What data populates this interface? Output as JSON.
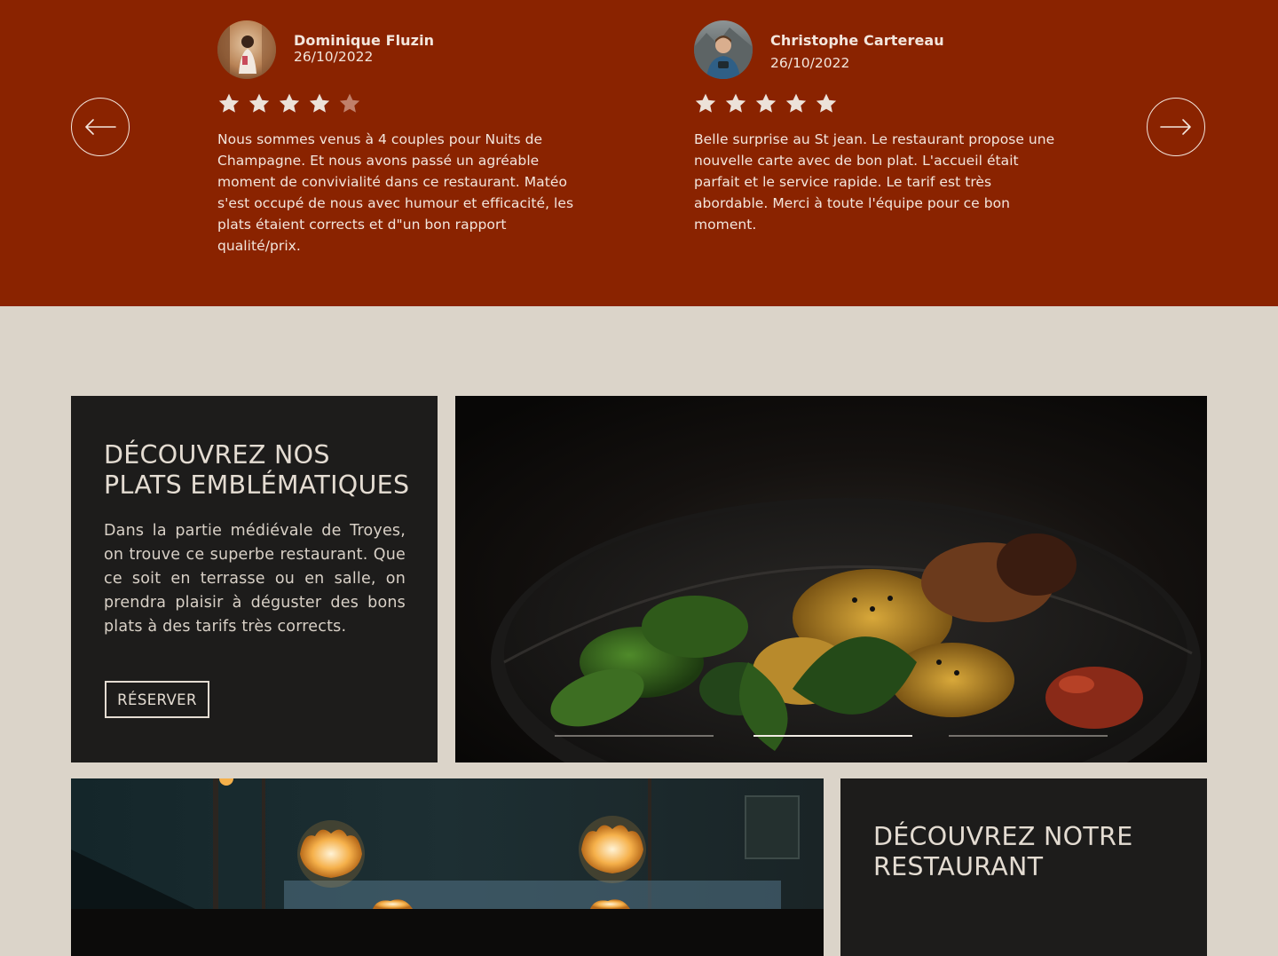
{
  "reviews": {
    "prev_icon": "arrow-left-icon",
    "next_icon": "arrow-right-icon",
    "items": [
      {
        "name": "Dominique Fluzin",
        "date": "26/10/2022",
        "rating": 4,
        "max_rating": 5,
        "text": "Nous sommes venus à 4 couples pour Nuits de Champagne. Et nous avons passé un agréable moment de convivialité dans ce restaurant. Matéo s'est occupé de nous avec humour et efficacité, les plats étaient corrects et d\"un bon rapport qualité/prix."
      },
      {
        "name": "Christophe Cartereau",
        "date": "26/10/2022",
        "rating": 5,
        "max_rating": 5,
        "text": "Belle surprise au St jean. Le restaurant propose une nouvelle carte avec de bon plat. L'accueil était parfait et le service rapide. Le tarif est très abordable. Merci à toute l'équipe pour ce bon moment."
      }
    ]
  },
  "dishes": {
    "title": "DÉCOUVREZ NOS PLATS EMBLÉMATIQUES",
    "text": "Dans la partie médiévale de Troyes, on trouve ce superbe restaurant. Que ce soit en terrasse ou en salle, on prendra plaisir à déguster des bons plats à des tarifs très corrects.",
    "button": "RÉSERVER",
    "slider": {
      "count": 3,
      "active": 2
    }
  },
  "restaurant": {
    "title": "DÉCOUVREZ NOTRE RESTAURANT"
  },
  "colors": {
    "reviews_bg": "#8a2300",
    "page_bg": "#dbd4c9",
    "card_bg": "#1d1c1b",
    "text_light": "#f3e6dc"
  }
}
